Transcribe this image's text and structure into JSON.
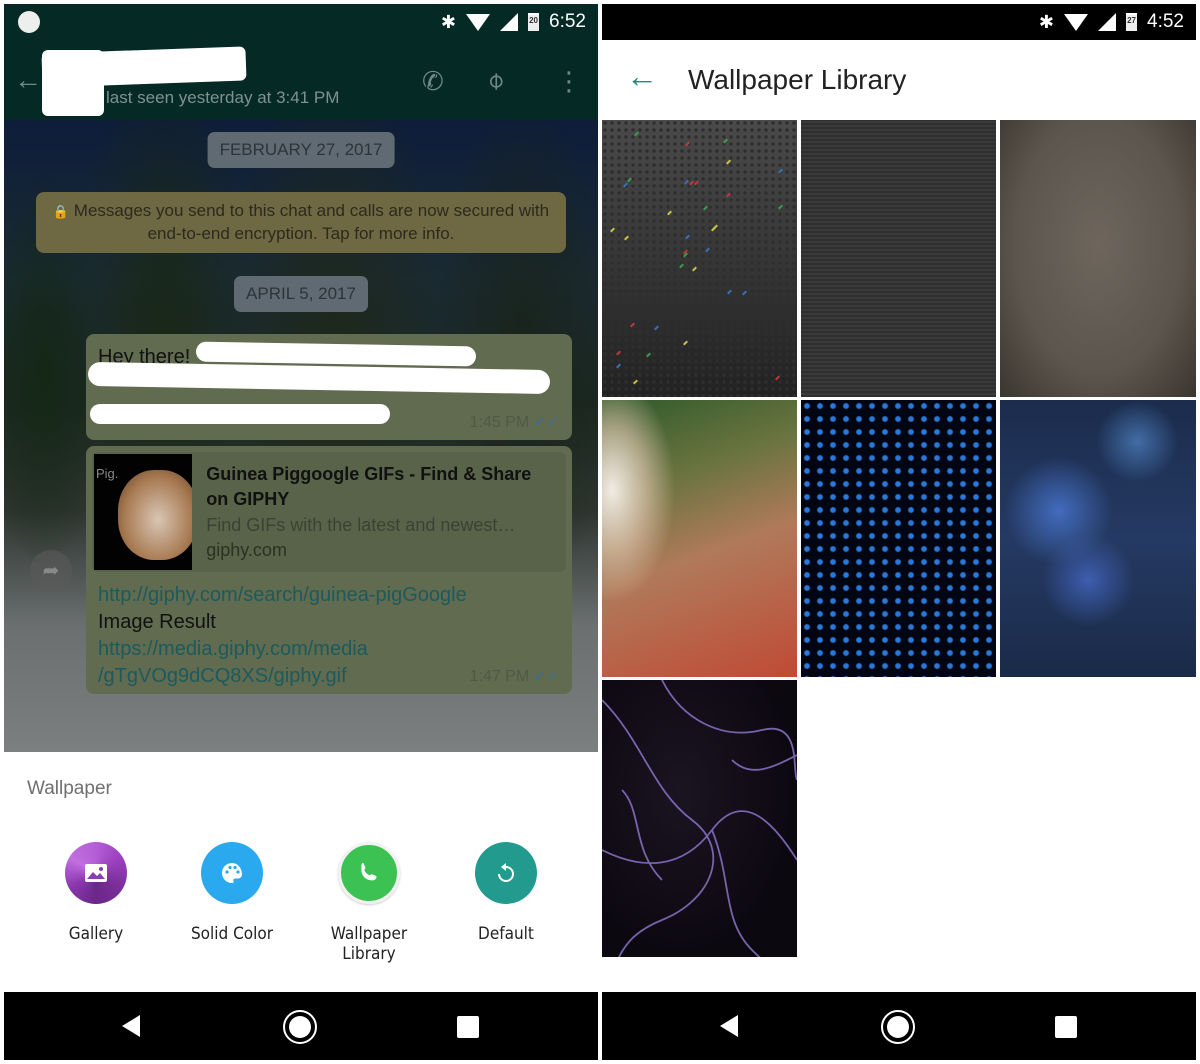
{
  "left": {
    "status_bar": {
      "time": "6:52",
      "battery": "20"
    },
    "chat_header": {
      "back_icon": "arrow-left-icon",
      "contact_name": "",
      "last_seen": "last seen yesterday at 3:41 PM",
      "actions": [
        "phone-icon",
        "paperclip-icon",
        "more-vert-icon"
      ]
    },
    "chat": {
      "date_chips": [
        "FEBRUARY 27, 2017",
        "APRIL 5, 2017"
      ],
      "encryption_notice": "Messages you send to this chat and calls are now secured with end-to-end encryption. Tap for more info.",
      "messages": [
        {
          "text": "Hey there!",
          "time": "1:45 PM",
          "ticks": "✓✓"
        },
        {
          "preview": {
            "thumb_label": "Pig.",
            "title": "Guinea Piggoogle GIFs - Find & Share on GIPHY",
            "description": "Find GIFs with the latest and newest…",
            "site": "giphy.com"
          },
          "link1": "http://giphy.com/search/guinea-pigGoogle",
          "middle_text": "Image Result",
          "link2_line1": "https://media.giphy.com/media",
          "link2_line2": "/gTgVOg9dCQ8XS/giphy.gif",
          "time": "1:47 PM",
          "ticks": "✓✓"
        }
      ]
    },
    "wallpaper_sheet": {
      "title": "Wallpaper",
      "options": [
        {
          "label": "Gallery",
          "icon": "gallery-icon"
        },
        {
          "label": "Solid Color",
          "icon": "palette-icon"
        },
        {
          "label": "Wallpaper Library",
          "icon": "whatsapp-icon"
        },
        {
          "label": "Default",
          "icon": "reset-icon"
        }
      ]
    }
  },
  "right": {
    "status_bar": {
      "time": "4:52",
      "battery": "27"
    },
    "app_bar": {
      "title": "Wallpaper Library",
      "back_icon": "arrow-left-icon"
    },
    "wallpapers": [
      {
        "name": "colorful-sparkles-dark"
      },
      {
        "name": "dark-carbon-mesh"
      },
      {
        "name": "brown-vintage-texture"
      },
      {
        "name": "green-red-light-blur"
      },
      {
        "name": "blue-led-dots"
      },
      {
        "name": "blue-bokeh"
      },
      {
        "name": "purple-plasma-lines"
      }
    ]
  },
  "glyphs": {
    "bluetooth": "✱",
    "back_arrow": "←",
    "phone": "✆",
    "paperclip": "📎",
    "more": "⋮",
    "forward": "➦"
  }
}
